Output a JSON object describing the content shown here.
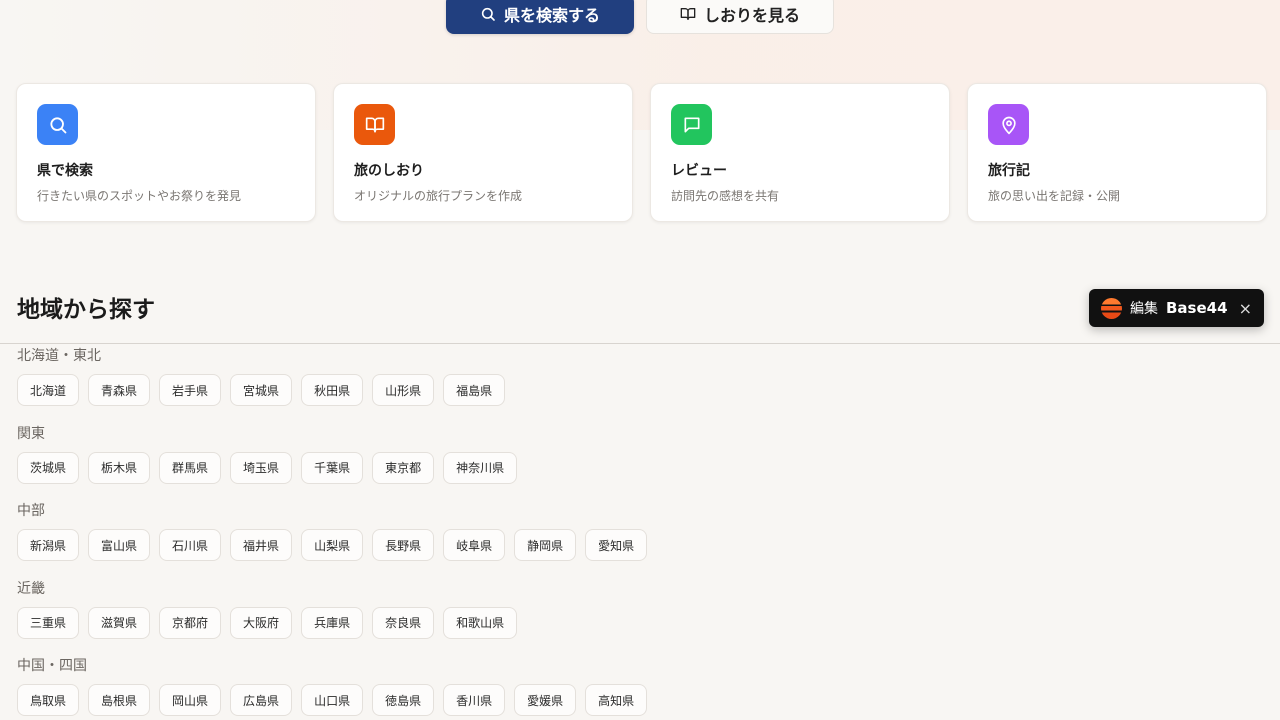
{
  "hero": {
    "search_button": "県を検索する",
    "shiori_button": "しおりを見る"
  },
  "features": [
    {
      "title": "県で検索",
      "desc": "行きたい県のスポットやお祭りを発見",
      "icon": "search-icon",
      "color": "#3b82f6"
    },
    {
      "title": "旅のしおり",
      "desc": "オリジナルの旅行プランを作成",
      "icon": "book-icon",
      "color": "#ea580c"
    },
    {
      "title": "レビュー",
      "desc": "訪問先の感想を共有",
      "icon": "message-icon",
      "color": "#22c55e"
    },
    {
      "title": "旅行記",
      "desc": "旅の思い出を記録・公開",
      "icon": "map-pin-icon",
      "color": "#a855f7"
    }
  ],
  "section": {
    "title": "地域から探す"
  },
  "regions": [
    {
      "name": "北海道・東北",
      "prefectures": [
        "北海道",
        "青森県",
        "岩手県",
        "宮城県",
        "秋田県",
        "山形県",
        "福島県"
      ]
    },
    {
      "name": "関東",
      "prefectures": [
        "茨城県",
        "栃木県",
        "群馬県",
        "埼玉県",
        "千葉県",
        "東京都",
        "神奈川県"
      ]
    },
    {
      "name": "中部",
      "prefectures": [
        "新潟県",
        "富山県",
        "石川県",
        "福井県",
        "山梨県",
        "長野県",
        "岐阜県",
        "静岡県",
        "愛知県"
      ]
    },
    {
      "name": "近畿",
      "prefectures": [
        "三重県",
        "滋賀県",
        "京都府",
        "大阪府",
        "兵庫県",
        "奈良県",
        "和歌山県"
      ]
    },
    {
      "name": "中国・四国",
      "prefectures": [
        "鳥取県",
        "島根県",
        "岡山県",
        "広島県",
        "山口県",
        "徳島県",
        "香川県",
        "愛媛県",
        "高知県"
      ]
    }
  ],
  "badge": {
    "edit_label": "編集",
    "brand": "Base44",
    "close": "×"
  }
}
